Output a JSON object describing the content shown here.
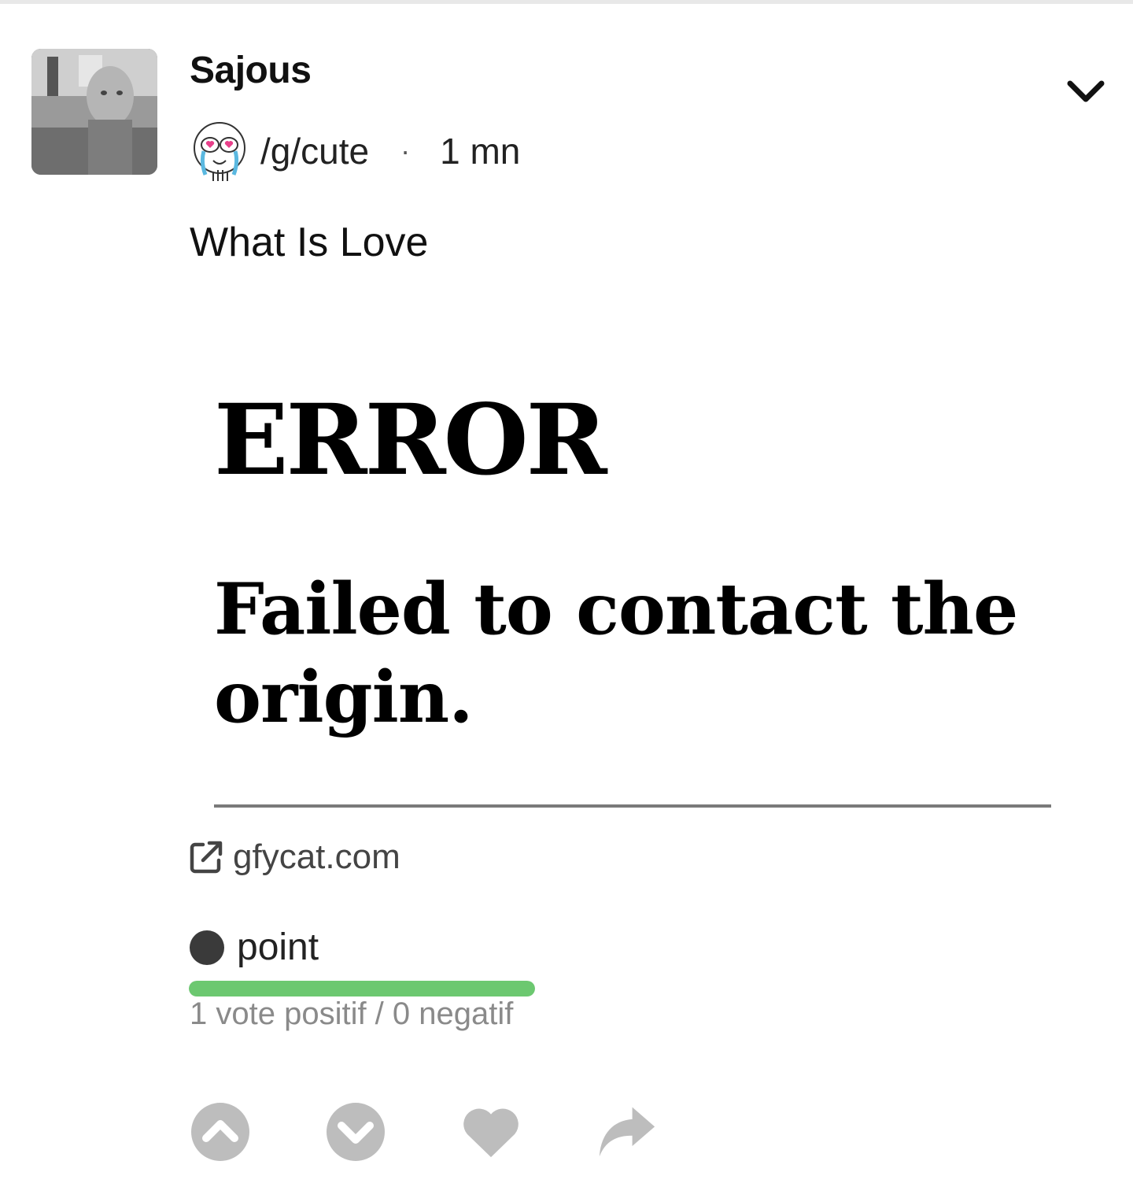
{
  "post": {
    "author": "Sajous",
    "group": "/g/cute",
    "separator": "·",
    "age": "1 mn",
    "title": "What Is Love"
  },
  "embed": {
    "error_heading": "ERROR",
    "error_message": "Failed to contact the origin.",
    "link_domain": "gfycat.com"
  },
  "score": {
    "label": "point",
    "votes_text": "1 vote positif / 0 negatif",
    "upvote_fraction": 1.0
  },
  "icons": {
    "menu": "chevron-down-icon",
    "external_link": "external-link-icon",
    "upvote": "upvote-icon",
    "downvote": "downvote-icon",
    "favorite": "heart-icon",
    "share": "share-icon"
  },
  "colors": {
    "vote_bar_fill": "#6cc870",
    "action_icon": "#bdbdbd"
  }
}
